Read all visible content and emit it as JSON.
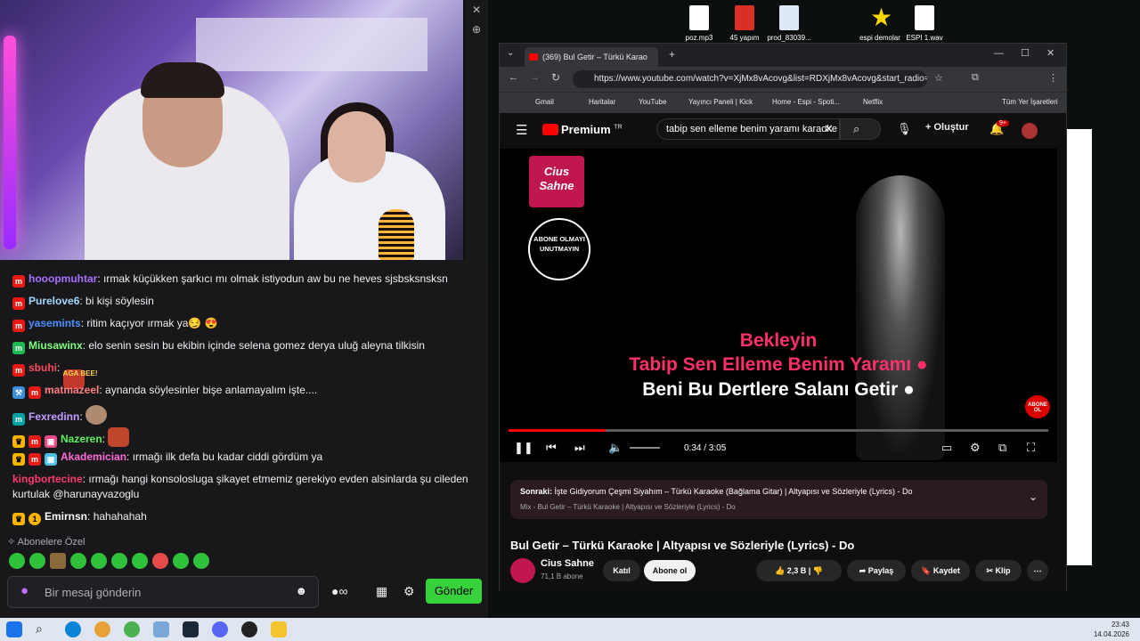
{
  "desktop": {
    "icons": [
      {
        "label": "poz.mp3",
        "type": "MP3"
      },
      {
        "label": "45 yapım",
        "type": "PDF"
      },
      {
        "label": "prod_83039...",
        "type": "DOC"
      },
      {
        "label": "espi demolar",
        "type": "STAR"
      },
      {
        "label": "ESPI 1.wav",
        "type": "WAV"
      }
    ]
  },
  "chat": {
    "messages": [
      {
        "user": "hooopmuhtar",
        "text": "ırmak küçükken şarkıcı mı olmak istiyodun aw bu ne heves sjsbsksnsksn",
        "color": "#a970ff"
      },
      {
        "user": "Purelove6",
        "text": "bi kişi söylesin",
        "color": "#a0d8ff"
      },
      {
        "user": "yasemints",
        "text": "ritim kaçıyor ırmak ya😏 😍",
        "color": "#4a90ff"
      },
      {
        "user": "Miusawinx",
        "text": "elo senin sesin bu ekibin içinde selena gomez derya uluğ aleyna tilkisin",
        "color": "#7dff7d"
      },
      {
        "user": "sbuhi",
        "text": "AGA BEE!",
        "color": "#ff4a5a"
      },
      {
        "user": "matmazeel",
        "text": "aynanda söylesinler bişe anlamayalım işte....",
        "color": "#ff7f7f"
      },
      {
        "user": "Fexredinn",
        "text": "",
        "color": "#c59bff"
      },
      {
        "user": "Nazeren",
        "text": "",
        "color": "#5af05a"
      },
      {
        "user": "Akademician",
        "text": "ırmağı ilk defa bu kadar ciddi gördüm ya",
        "color": "#ff6bd6"
      },
      {
        "user": "kingbortecine",
        "text": "ırmağı hangi konsolosluga şikayet etmemiz gerekiyo evden alsinlarda şu cileden",
        "text2": "kurtulak @harunayvazoglu",
        "color": "#ff3a6e"
      },
      {
        "user": "Emirnsn",
        "text": "hahahahah",
        "color": "#ffffff"
      }
    ],
    "subs_label": "Abonelere Özel",
    "input_placeholder": "Bir mesaj gönderin",
    "send_label": "Gönder"
  },
  "browser": {
    "tab_title": "(369) Bul Getir – Türkü Karao",
    "url": "https://www.youtube.com/watch?v=XjMx8vAcovg&list=RDXjMx8vAcovg&start_radio=1",
    "bookmarks": [
      "Gmail",
      "Haritalar",
      "YouTube",
      "Yayıncı Paneli | Kick",
      "Home - Espi - Spoti...",
      "Netflix"
    ],
    "all_bookmarks": "Tüm Yer İşaretleri"
  },
  "youtube": {
    "logo": "Premium",
    "logo_region": "TR",
    "search_query": "tabip sen elleme benim yaramı karaoke",
    "create_label": "Oluştur",
    "notif_count": "9+",
    "video": {
      "channel_logo": "Cius Sahne",
      "abone_badge": "ABONE OLMAYI UNUTMAYIN",
      "lyric_1": "Bekleyin",
      "lyric_2": "Tabip Sen Elleme Benim Yaramı ●",
      "lyric_3": "Beni Bu Dertlere Salanı Getir ●",
      "corner_badge": "ABONE OL",
      "time": "0:34 / 3:05",
      "progress": 0.18
    },
    "up_next_label": "Sonraki:",
    "up_next_title": "İşte Gidiyorum Çeşmi Siyahım – Türkü Karaoke (Bağlama Gitar) | Altyapısı ve Sözleriyle (Lyrics) - Do",
    "up_next_sub": "Mix - Bul Getir – Türkü Karaoke | Altyapısı ve Sözleriyle (Lyrics) - Do",
    "title": "Bul Getir – Türkü Karaoke | Altyapısı ve Sözleriyle (Lyrics) - Do",
    "channel": "Cius Sahne",
    "channel_subs": "71,1 B abone",
    "join_label": "Katıl",
    "subscribe_label": "Abone ol",
    "likes": "2,3 B",
    "share_label": "Paylaş",
    "save_label": "Kaydet",
    "clip_label": "Klip"
  },
  "taskbar": {
    "time": "23:43",
    "date": "14.04.2026"
  }
}
